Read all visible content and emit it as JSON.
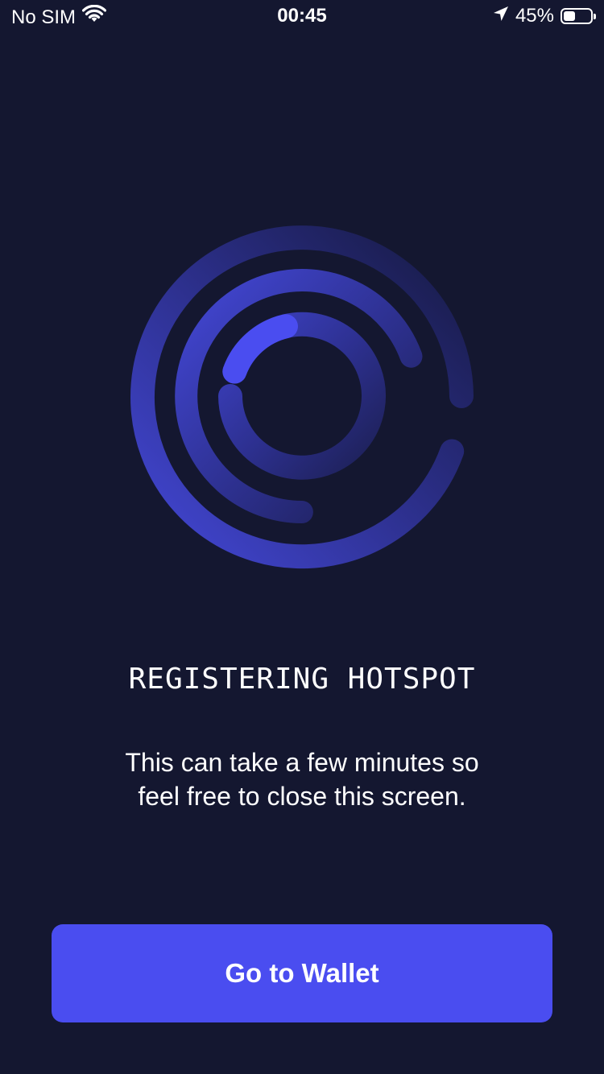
{
  "status_bar": {
    "carrier": "No SIM",
    "time": "00:45",
    "battery_percent": "45%",
    "battery_level": 0.45,
    "icons": [
      "wifi-icon",
      "location-arrow-icon",
      "battery-icon"
    ]
  },
  "main": {
    "title": "REGISTERING HOTSPOT",
    "subtitle_line1": "This can take a few minutes so",
    "subtitle_line2": "feel free to close this screen."
  },
  "actions": {
    "go_to_wallet_label": "Go to Wallet"
  },
  "colors": {
    "background": "#141730",
    "accent": "#4a4df0",
    "text": "#ffffff"
  }
}
